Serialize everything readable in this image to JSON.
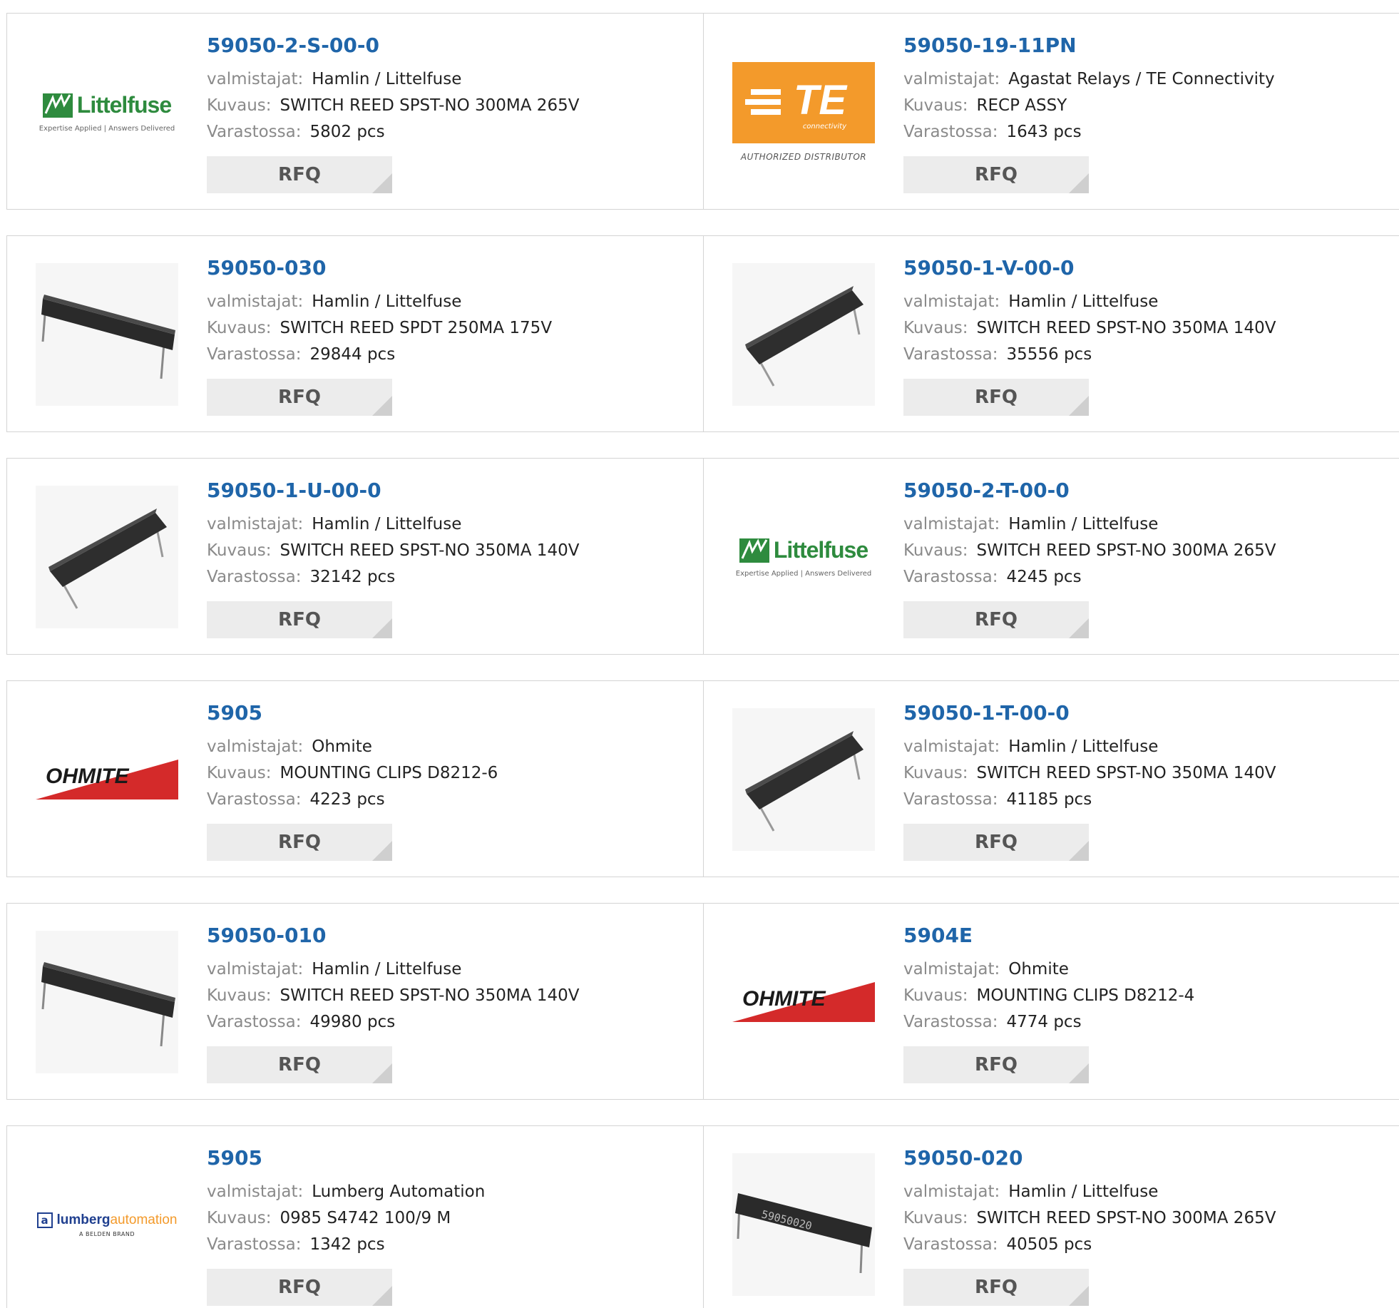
{
  "labels": {
    "manufacturer": "valmistajat:",
    "description": "Kuvaus:",
    "stock": "Varastossa:",
    "rfq": "RFQ"
  },
  "products": [
    {
      "part": "59050-2-S-00-0",
      "manufacturer": "Hamlin / Littelfuse",
      "description": "SWITCH REED SPST-NO 300MA 265V",
      "stock": "5802 pcs",
      "image": "littelfuse-logo"
    },
    {
      "part": "59050-19-11PN",
      "manufacturer": "Agastat Relays / TE Connectivity",
      "description": "RECP ASSY",
      "stock": "1643 pcs",
      "image": "te-connectivity-logo"
    },
    {
      "part": "59050-030",
      "manufacturer": "Hamlin / Littelfuse",
      "description": "SWITCH REED SPDT 250MA 175V",
      "stock": "29844 pcs",
      "image": "reed-switch-photo"
    },
    {
      "part": "59050-1-V-00-0",
      "manufacturer": "Hamlin / Littelfuse",
      "description": "SWITCH REED SPST-NO 350MA 140V",
      "stock": "35556 pcs",
      "image": "reed-switch-angled-photo"
    },
    {
      "part": "59050-1-U-00-0",
      "manufacturer": "Hamlin / Littelfuse",
      "description": "SWITCH REED SPST-NO 350MA 140V",
      "stock": "32142 pcs",
      "image": "reed-switch-angled-photo"
    },
    {
      "part": "59050-2-T-00-0",
      "manufacturer": "Hamlin / Littelfuse",
      "description": "SWITCH REED SPST-NO 300MA 265V",
      "stock": "4245 pcs",
      "image": "littelfuse-logo"
    },
    {
      "part": "5905",
      "manufacturer": "Ohmite",
      "description": "MOUNTING CLIPS D8212-6",
      "stock": "4223 pcs",
      "image": "ohmite-logo"
    },
    {
      "part": "59050-1-T-00-0",
      "manufacturer": "Hamlin / Littelfuse",
      "description": "SWITCH REED SPST-NO 350MA 140V",
      "stock": "41185 pcs",
      "image": "reed-switch-angled-photo"
    },
    {
      "part": "59050-010",
      "manufacturer": "Hamlin / Littelfuse",
      "description": "SWITCH REED SPST-NO 350MA 140V",
      "stock": "49980 pcs",
      "image": "reed-switch-photo"
    },
    {
      "part": "5904E",
      "manufacturer": "Ohmite",
      "description": "MOUNTING CLIPS D8212-4",
      "stock": "4774 pcs",
      "image": "ohmite-logo"
    },
    {
      "part": "5905",
      "manufacturer": "Lumberg Automation",
      "description": "0985 S4742 100/9 M",
      "stock": "1342 pcs",
      "image": "lumberg-automation-logo"
    },
    {
      "part": "59050-020",
      "manufacturer": "Hamlin / Littelfuse",
      "description": "SWITCH REED SPST-NO 300MA 265V",
      "stock": "40505 pcs",
      "image": "reed-switch-printed-photo"
    }
  ],
  "logos": {
    "littelfuse": {
      "name": "Littelfuse",
      "tagline": "Expertise Applied | Answers Delivered",
      "color": "#2e8b3e"
    },
    "te": {
      "name": "TE",
      "sub": "connectivity",
      "caption": "AUTHORIZED DISTRIBUTOR",
      "color": "#f39a2b"
    },
    "ohmite": {
      "name": "OHMITE",
      "color": "#d42a2a"
    },
    "lumberg": {
      "name_a": "lumberg",
      "name_b": "automation",
      "tagline": "A BELDEN BRAND",
      "color_a": "#1f3f8f",
      "color_b": "#f39a2b"
    },
    "switch_print": "59050020"
  },
  "colors": {
    "part_link": "#1f65a9",
    "label": "#8a8a8a",
    "rfq_bg": "#ececec"
  }
}
